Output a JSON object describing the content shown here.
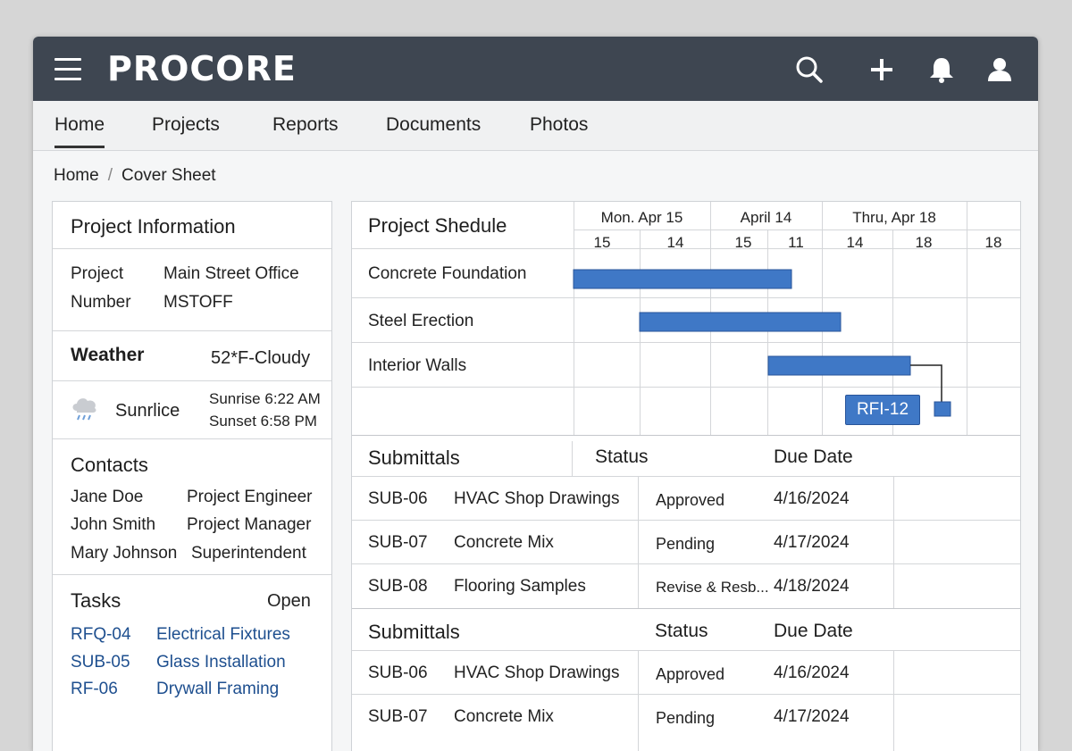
{
  "app": {
    "logo": "PROCORE",
    "icons": [
      "menu-icon",
      "search-icon",
      "plus-icon",
      "bell-icon",
      "user-icon"
    ],
    "colors": {
      "topbar": "#3e4651",
      "bar": "#3f78c6",
      "link": "#1e4f8f"
    }
  },
  "nav": {
    "tabs": [
      "Home",
      "Projects",
      "Reports",
      "Documents",
      "Photos"
    ],
    "active": "Home"
  },
  "breadcrumb": {
    "home": "Home",
    "sep": "/",
    "current": "Cover Sheet"
  },
  "project_info": {
    "title": "Project Information",
    "label1": "Project",
    "label2": "Number",
    "value1": "Main Street Office",
    "value2": "MSTOFF"
  },
  "weather": {
    "title": "Weather",
    "current": "52*F-Cloudy",
    "location": "Sunrlice",
    "sunrise": "Sunrise 6:22 AM",
    "sunset": "Sunset  6:58 PM"
  },
  "contacts": {
    "title": "Contacts",
    "rows": [
      {
        "name": "Jane Doe",
        "role": "Project Engineer"
      },
      {
        "name": "John Smith",
        "role": "Project Manager"
      },
      {
        "name": "Mary Johnson",
        "role": "Superintendent"
      }
    ]
  },
  "tasks": {
    "title": "Tasks",
    "status": "Open",
    "rows": [
      {
        "id": "RFQ-04",
        "name": "Electrical Fixtures"
      },
      {
        "id": "SUB-05",
        "name": "Glass Installation"
      },
      {
        "id": "RF-06",
        "name": "Drywall Framing"
      }
    ]
  },
  "schedule": {
    "title": "Project Shedule",
    "date_groups": [
      "Mon. Apr 15",
      "April 14",
      "Thru, Apr 18"
    ],
    "days": [
      "15",
      "14",
      "15",
      "11",
      "14",
      "18",
      "18"
    ],
    "rows": [
      {
        "name": "Concrete Foundation"
      },
      {
        "name": "Steel Erection"
      },
      {
        "name": "Interior Walls"
      }
    ],
    "milestone": "RFI-12"
  },
  "submittals1": {
    "headers": {
      "name": "Submittals",
      "status": "Status",
      "due": "Due Date"
    },
    "rows": [
      {
        "id": "SUB-06",
        "name": "HVAC Shop Drawings",
        "status": "Approved",
        "due": "4/16/2024"
      },
      {
        "id": "SUB-07",
        "name": "Concrete Mix",
        "status": "Pending",
        "due": "4/17/2024"
      },
      {
        "id": "SUB-08",
        "name": "Flooring Samples",
        "status": "Revise & Resb...",
        "due": "4/18/2024"
      }
    ]
  },
  "submittals2": {
    "headers": {
      "name": "Submittals",
      "status": "Status",
      "due": "Due Date"
    },
    "rows": [
      {
        "id": "SUB-06",
        "name": "HVAC Shop Drawings",
        "status": "Approved",
        "due": "4/16/2024"
      },
      {
        "id": "SUB-07",
        "name": "Concrete Mix",
        "status": "Pending",
        "due": "4/17/2024"
      }
    ]
  }
}
